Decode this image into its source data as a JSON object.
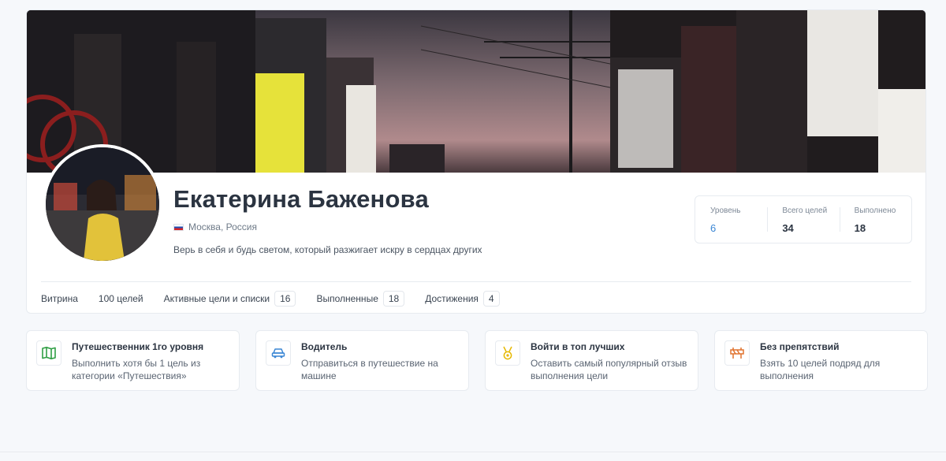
{
  "profile": {
    "name": "Екатерина Баженова",
    "location": "Москва, Россия",
    "bio": "Верь в себя и будь светом, который разжигает искру в сердцах других"
  },
  "stats": [
    {
      "label": "Уровень",
      "value": "6"
    },
    {
      "label": "Всего целей",
      "value": "34"
    },
    {
      "label": "Выполнено",
      "value": "18"
    }
  ],
  "tabs": [
    {
      "label": "Витрина"
    },
    {
      "label": "100 целей"
    },
    {
      "label": "Активные цели и списки",
      "count": "16"
    },
    {
      "label": "Выполненные",
      "count": "18"
    },
    {
      "label": "Достижения",
      "count": "4",
      "active": true
    }
  ],
  "achievements": [
    {
      "icon": "map-icon",
      "color": "#2f9e44",
      "title": "Путешественник 1го уровня",
      "description": "Выполнить хотя бы 1 цель из категории «Путешествия»"
    },
    {
      "icon": "car-icon",
      "color": "#3a86d4",
      "title": "Водитель",
      "description": "Отправиться в путешествие на машине"
    },
    {
      "icon": "medal-icon",
      "color": "#e6b800",
      "title": "Войти в топ лучших",
      "description": "Оставить самый популярный отзыв выполнения цели"
    },
    {
      "icon": "barrier-icon",
      "color": "#e0722e",
      "title": "Без препятствий",
      "description": "Взять 10 целей подряд для выполнения"
    }
  ],
  "colors": {
    "accent": "#3a86d4"
  }
}
